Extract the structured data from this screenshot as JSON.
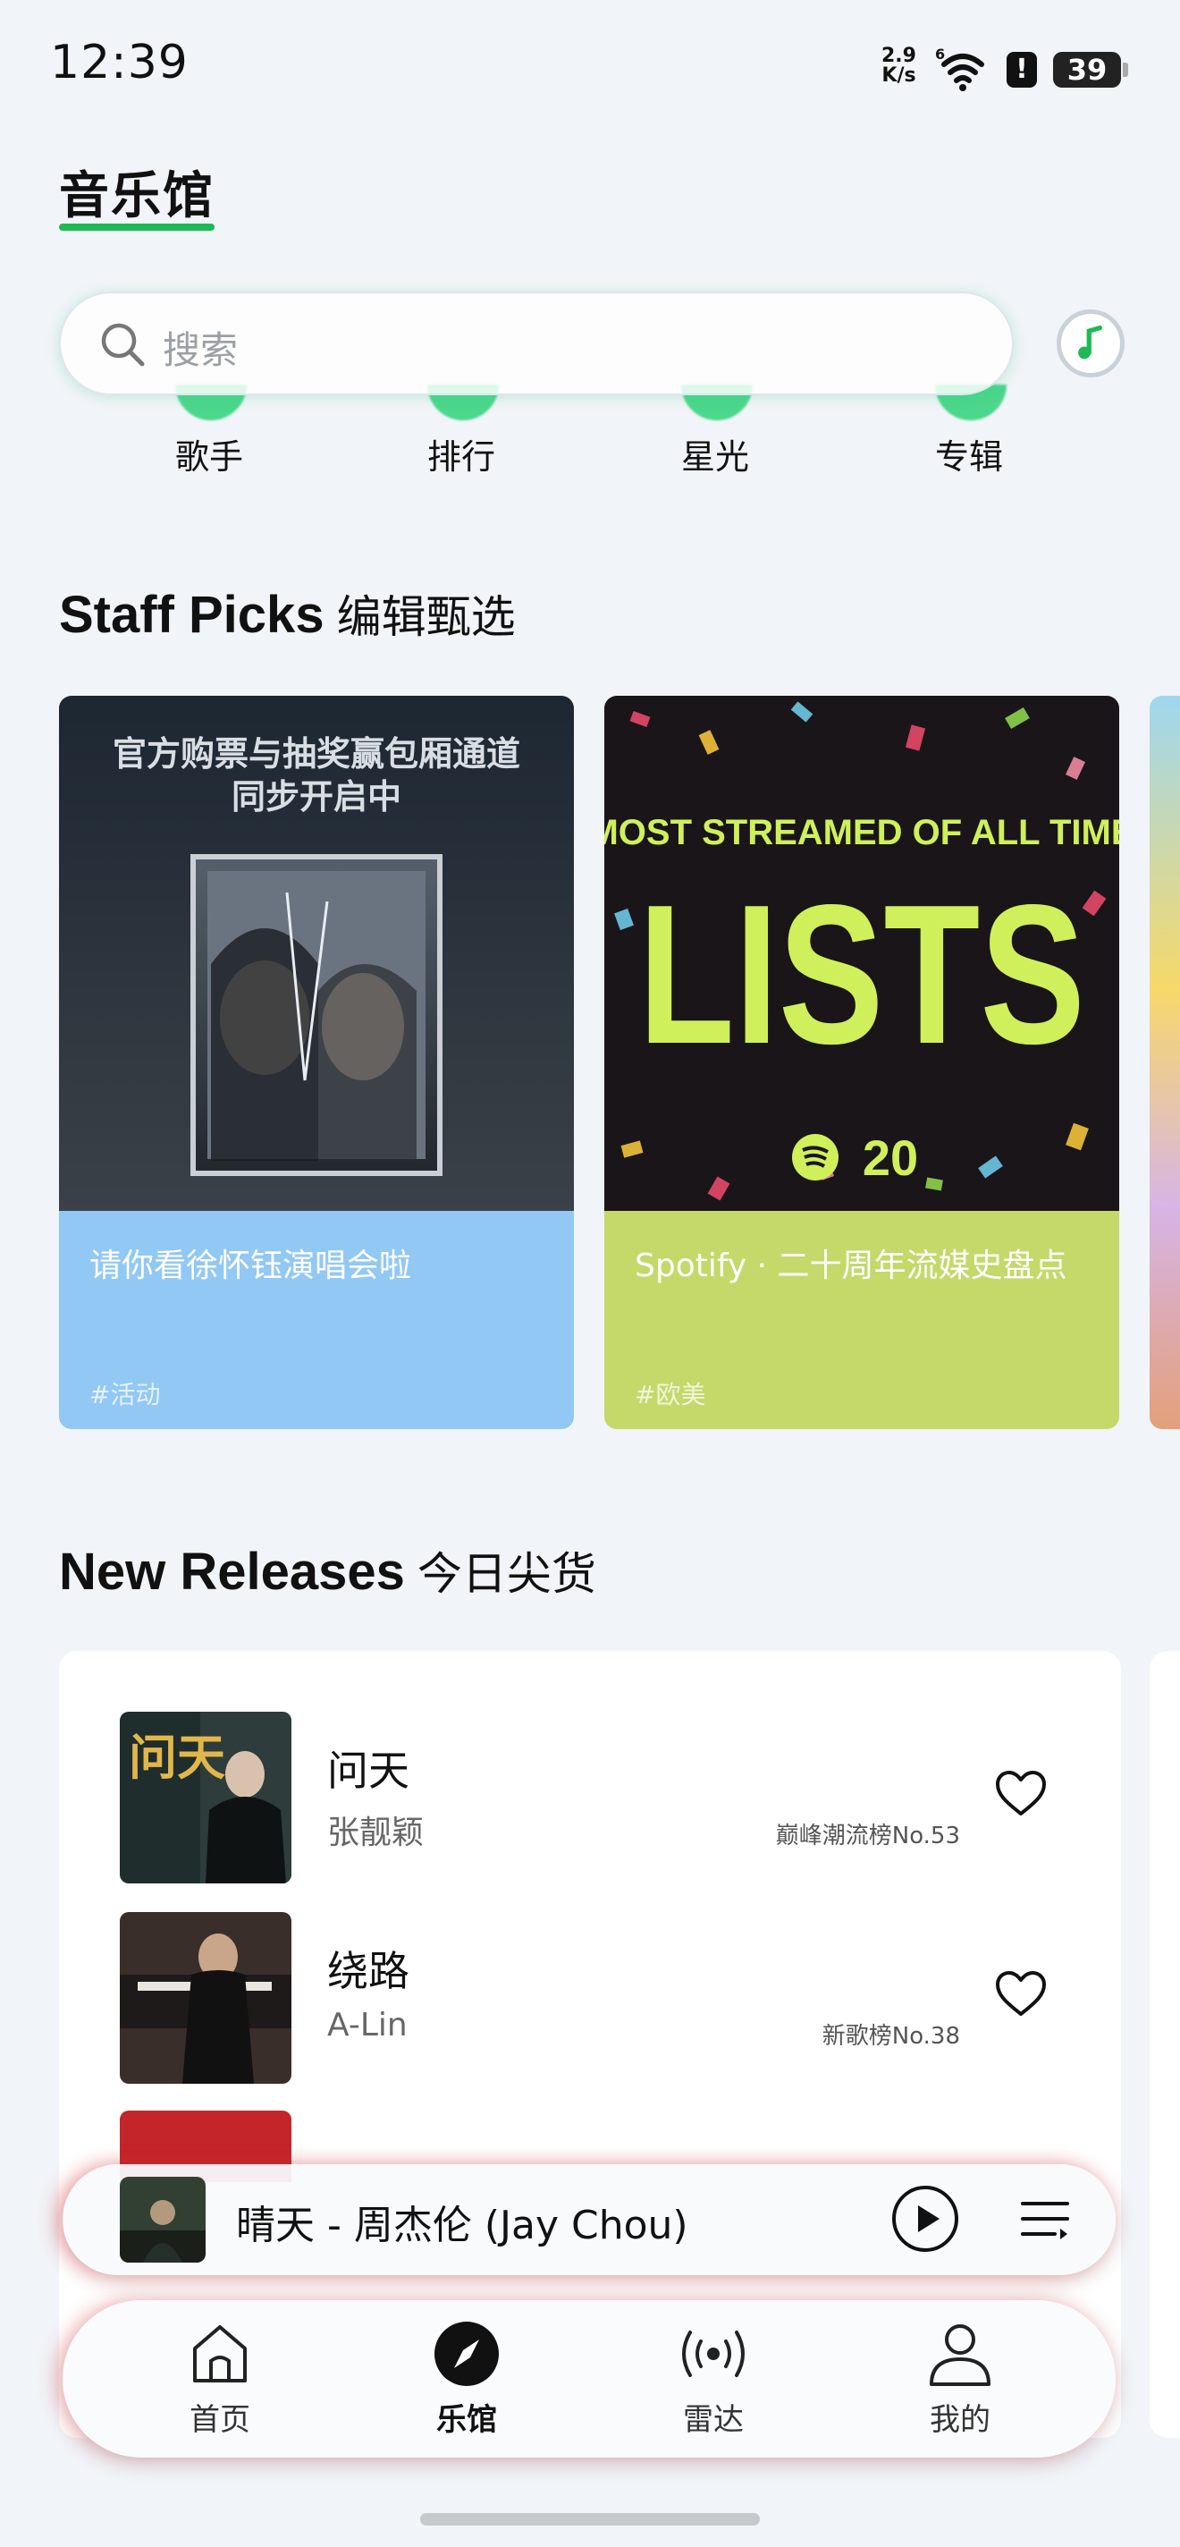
{
  "status_bar": {
    "time": "12:39",
    "net_speed_value": "2.9",
    "net_speed_unit": "K/s",
    "wifi_label": "6",
    "battery": "39"
  },
  "header": {
    "title": "音乐馆"
  },
  "search": {
    "placeholder": "搜索"
  },
  "categories": [
    {
      "label": "歌手",
      "icon": "singer-icon"
    },
    {
      "label": "排行",
      "icon": "chart-icon"
    },
    {
      "label": "星光",
      "icon": "star-icon"
    },
    {
      "label": "专辑",
      "icon": "album-icon"
    }
  ],
  "staff_picks": {
    "title_en": "Staff Picks",
    "title_zh": "编辑甄选",
    "cards": [
      {
        "banner_line1": "官方购票与抽奖赢包厢通道",
        "banner_line2": "同步开启中",
        "title": "请你看徐怀钰演唱会啦",
        "tag": "#活动",
        "color": "#92c8f4"
      },
      {
        "banner_top": "MOST STREAMED OF ALL TIME",
        "banner_main": "LISTS",
        "banner_badge": "20",
        "title": "Spotify · 二十周年流媒史盘点",
        "tag": "#欧美",
        "color": "#c5d86a"
      }
    ]
  },
  "new_releases": {
    "title_en": "New Releases",
    "title_zh": "今日尖货",
    "items": [
      {
        "title": "问天",
        "artist": "张靓颖",
        "rank": "巅峰潮流榜No.53",
        "cover_text": "问天"
      },
      {
        "title": "绕路",
        "artist": "A-Lin",
        "rank": "新歌榜No.38"
      }
    ]
  },
  "mini_player": {
    "now_playing": "晴天 - 周杰伦 (Jay Chou)"
  },
  "bottom_nav": [
    {
      "label": "首页",
      "icon": "home-icon"
    },
    {
      "label": "乐馆",
      "icon": "compass-icon",
      "active": true
    },
    {
      "label": "雷达",
      "icon": "radar-icon"
    },
    {
      "label": "我的",
      "icon": "profile-icon"
    }
  ],
  "colors": {
    "accent": "#1db954",
    "card1": "#92c8f4",
    "card2": "#c5d86a"
  }
}
